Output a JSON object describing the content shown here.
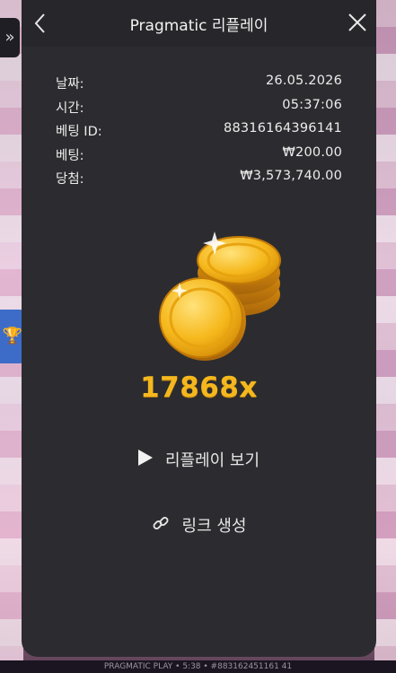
{
  "modal": {
    "title": "Pragmatic 리플레이",
    "info": [
      {
        "label": "날짜:",
        "value": "26.05.2026"
      },
      {
        "label": "시간:",
        "value": "05:37:06"
      },
      {
        "label": "베팅 ID:",
        "value": "88316164396141"
      },
      {
        "label": "베팅:",
        "value": "₩200.00"
      },
      {
        "label": "당첨:",
        "value": "₩3,573,740.00"
      }
    ],
    "multiplier": "17868x",
    "actions": {
      "replay_label": "리플레이 보기",
      "link_label": "링크 생성"
    }
  },
  "background": {
    "footer_text": "PRAGMATIC PLAY • 5:38 • #883162451161 41"
  },
  "icons": {
    "back": "back-chevron-icon",
    "close": "close-icon",
    "play": "play-icon",
    "link": "link-icon",
    "trophy": "trophy-icon",
    "expand": "double-chevron-icon",
    "coins": "gold-coins-icon"
  },
  "colors": {
    "accent_gold": "#f4b81e",
    "modal_bg": "#2c2c30",
    "header_bg": "#27272b"
  }
}
